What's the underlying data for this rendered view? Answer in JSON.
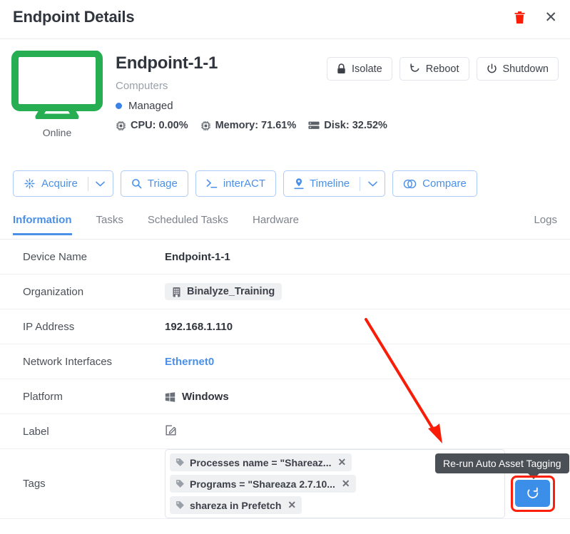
{
  "header": {
    "title": "Endpoint Details",
    "delete_icon": "trash-icon",
    "close_icon": "close-icon",
    "close_glyph": "✕"
  },
  "summary": {
    "status_label": "Online",
    "device_name": "Endpoint-1-1",
    "group": "Computers",
    "managed_status": "Managed",
    "metrics": [
      {
        "icon": "cpu-icon",
        "label": "CPU: 0.00%"
      },
      {
        "icon": "memory-icon",
        "label": "Memory: 71.61%"
      },
      {
        "icon": "disk-icon",
        "label": "Disk: 32.52%"
      }
    ],
    "power_actions": [
      {
        "icon": "lock-icon",
        "label": "Isolate"
      },
      {
        "icon": "reboot-icon",
        "label": "Reboot"
      },
      {
        "icon": "power-icon",
        "label": "Shutdown"
      }
    ]
  },
  "toolbar": {
    "buttons": [
      {
        "icon": "acquire-icon",
        "label": "Acquire",
        "caret": true
      },
      {
        "icon": "search-icon",
        "label": "Triage",
        "caret": false
      },
      {
        "icon": "terminal-icon",
        "label": "interACT",
        "caret": false
      },
      {
        "icon": "timeline-pin-icon",
        "label": "Timeline",
        "caret": true
      },
      {
        "icon": "compare-icon",
        "label": "Compare",
        "caret": false
      }
    ]
  },
  "tabs": {
    "left": [
      {
        "label": "Information",
        "active": true
      },
      {
        "label": "Tasks",
        "active": false
      },
      {
        "label": "Scheduled Tasks",
        "active": false
      },
      {
        "label": "Hardware",
        "active": false
      }
    ],
    "right": {
      "label": "Logs",
      "active": false
    }
  },
  "details": {
    "device_name": {
      "label": "Device Name",
      "value": "Endpoint-1-1"
    },
    "organization": {
      "label": "Organization",
      "value": "Binalyze_Training",
      "icon": "building-icon"
    },
    "ip_address": {
      "label": "IP Address",
      "value": "192.168.1.110"
    },
    "network_interfaces": {
      "label": "Network Interfaces",
      "value": "Ethernet0"
    },
    "platform": {
      "label": "Platform",
      "value": "Windows",
      "icon": "windows-icon"
    },
    "label": {
      "label": "Label",
      "value": "",
      "icon": "edit-icon"
    },
    "tags": {
      "label": "Tags",
      "chips": [
        {
          "text": "Processes name = \"Shareaz...",
          "remove": "✕"
        },
        {
          "text": "Programs = \"Shareaza 2.7.10...",
          "remove": "✕"
        },
        {
          "text": "shareza in Prefetch",
          "remove": "✕"
        }
      ]
    }
  },
  "rerun": {
    "tooltip": "Re-run Auto Asset Tagging",
    "icon": "refresh-icon"
  },
  "colors": {
    "accent_blue": "#4a90e8",
    "button_blue": "#3b8fe8",
    "online_green": "#27ae52",
    "delete_red": "#f91c07",
    "highlight_red": "#fb1f0c",
    "tooltip_bg": "#4b5057",
    "text_primary": "#2f343d",
    "text_secondary": "#7d838c"
  }
}
